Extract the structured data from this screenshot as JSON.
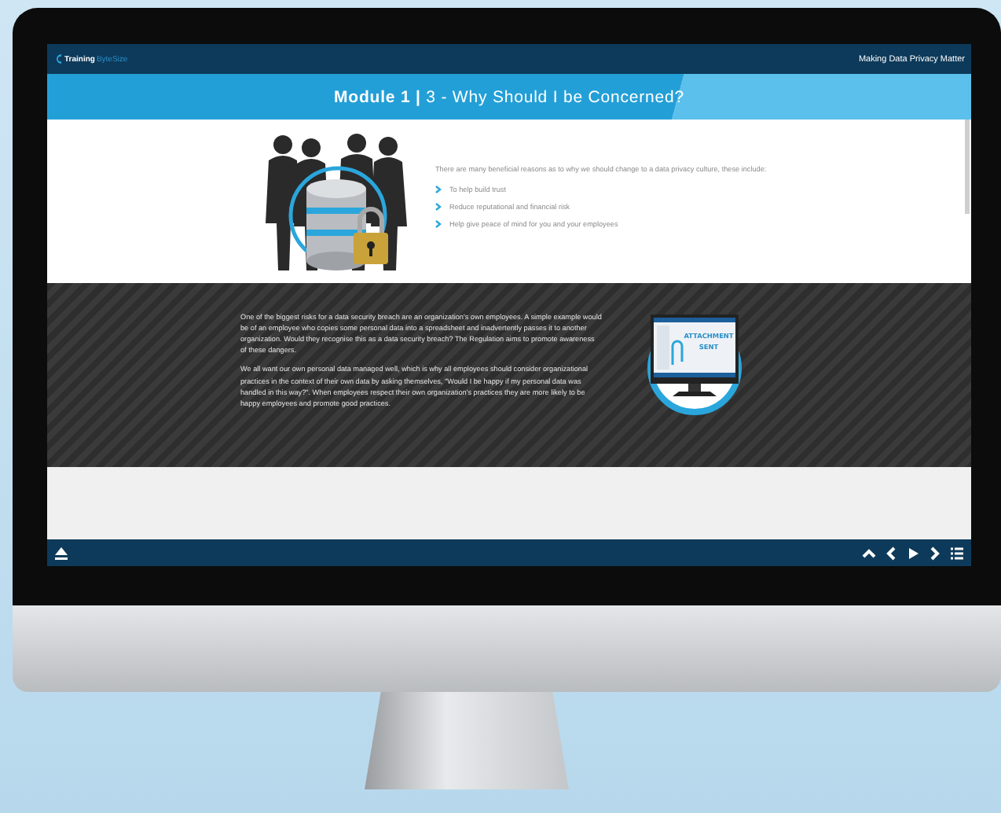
{
  "header": {
    "logo": {
      "name": "Training",
      "suffix": "ByteSize"
    },
    "tagline": "Making Data Privacy Matter"
  },
  "title": "**Module 1 |** 3 - Why Should I be Concerned?",
  "intro": {
    "text": "There are many beneficial reasons as to why we should change to a data privacy culture, these include:",
    "bullets": [
      "To help build trust",
      "Reduce reputational and financial risk",
      "Help give peace of mind for you and your employees"
    ]
  },
  "feature": {
    "paragraphs": [
      "One of the biggest risks for a data security breach are an organization's own employees. A simple example would be of an employee who copies some personal data into a spreadsheet and inadvertently passes it to another organization. Would they recognise this as a data security breach? The Regulation aims to promote awareness of these dangers.",
      "We all want our own personal data managed well, which is why all employees should consider organizational practices in the context of their own data by asking themselves, \"Would I be happy if my personal data was handled in this way?\". When employees respect their own organization's practices they are more likely to be happy employees and promote good practices."
    ],
    "illustration_label": [
      "ATTACHMENT",
      "SENT"
    ]
  },
  "nav": {
    "left": [
      {
        "kind": "eject"
      }
    ],
    "right": [
      {
        "kind": "up"
      },
      {
        "kind": "prev"
      },
      {
        "kind": "play"
      },
      {
        "kind": "next"
      },
      {
        "kind": "menu"
      }
    ]
  }
}
